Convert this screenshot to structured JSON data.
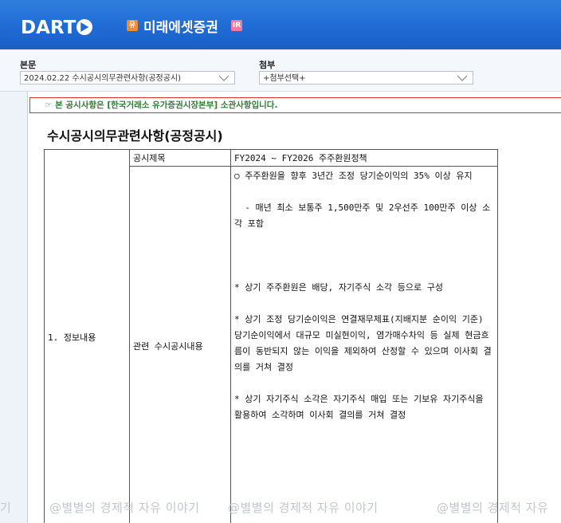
{
  "header": {
    "logo_text": "DART",
    "badge_left": "유",
    "company_name": "미래에셋증권",
    "badge_right": "IR",
    "bg_color": "#1f6bd4"
  },
  "selectors": {
    "main_label": "본문",
    "main_value": "2024.02.22  수시공시의무관련사항(공정공시)",
    "attach_label": "첨부",
    "attach_value": "+첨부선택+"
  },
  "document": {
    "notice": "☞ 본 공시사항은 [한국거래소 유가증권시장본부] 소관사항입니다.",
    "title": "수시공시의무관련사항(공정공시)",
    "table": {
      "row_label": "1. 정보내용",
      "subject_label": "공시제목",
      "subject_value": "FY2024 ~ FY2026 주주환원정책",
      "content_label": "관련 수시공시내용",
      "content_paragraphs": [
        "○ 주주환원을 향후 3년간 조정 당기순이익의 35% 이상 유지",
        "",
        "  - 매년 최소 보통주 1,500만주 및 2우선주 100만주 이상 소각 포함",
        "",
        "",
        "",
        "* 상기 주주환원은 배당, 자기주식 소각 등으로 구성",
        "",
        "* 상기 조정 당기순이익은 연결재무제표(지배지분 순이익 기준) 당기순이익에서 대규모 미실현이익, 염가매수차익 등 실제 현금흐름이 동반되지 않는 이익을 제외하여 산정할 수 있으며 이사회 결의를 거쳐 결정",
        "",
        "* 상기 자기주식 소각은 자기주식 매입 또는 기보유 자기주식을 활용하여 소각하며 이사회 결의를 거쳐 결정"
      ]
    }
  },
  "watermark": {
    "segments": [
      "기",
      "@별별의 경제적 자유 이야기",
      "@별별의 경제적 자유 이야기",
      "@별별의 경제적 자유"
    ]
  }
}
